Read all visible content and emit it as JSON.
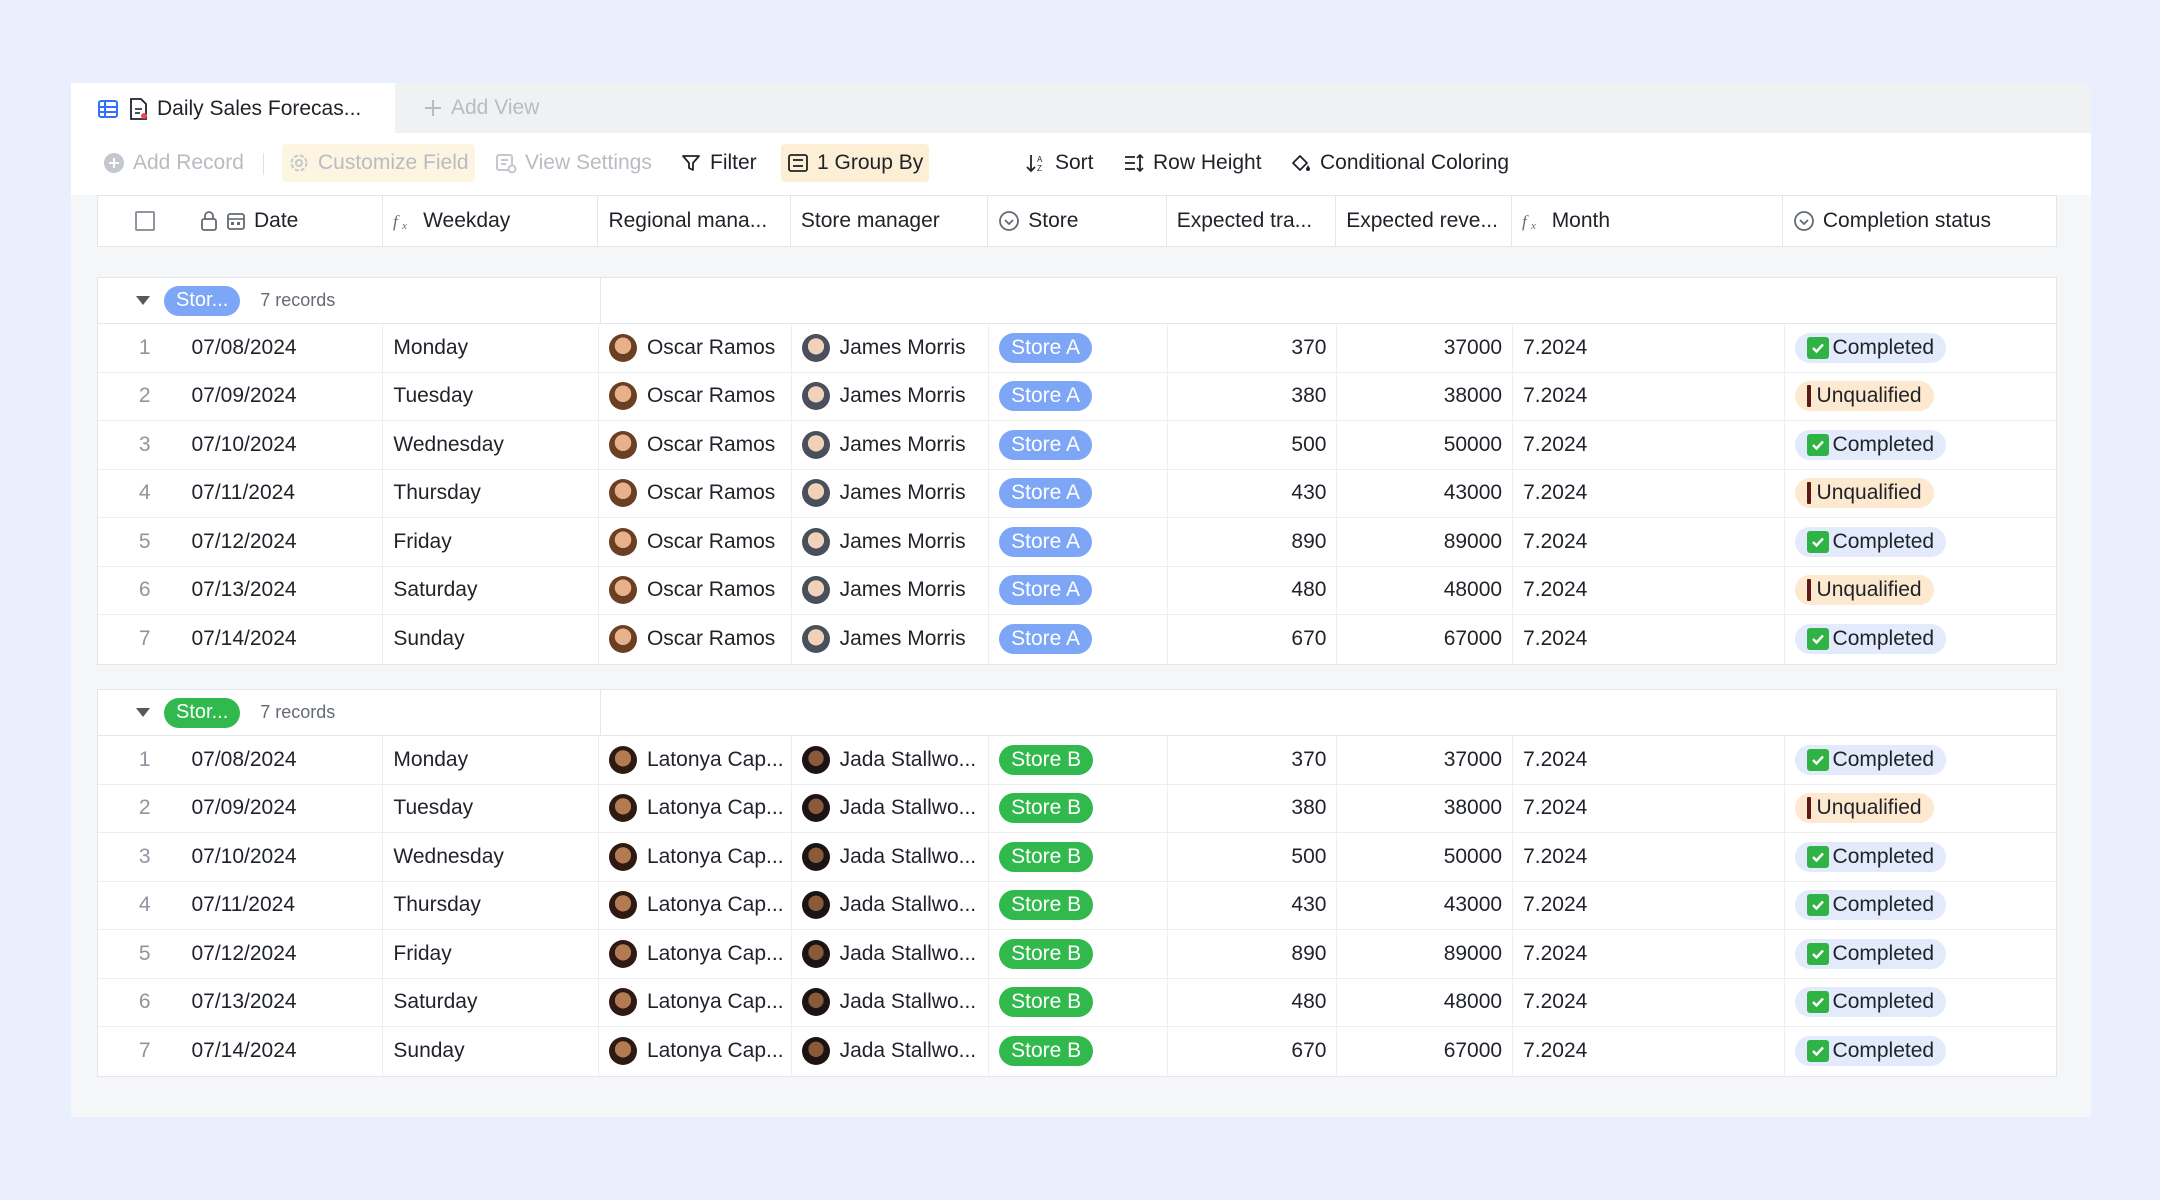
{
  "tabs": {
    "active_label": "Daily Sales Forecas...",
    "add_view_label": "Add View"
  },
  "toolbar": {
    "add_record": "Add Record",
    "customize_field": "Customize Field",
    "view_settings": "View Settings",
    "filter": "Filter",
    "group_by": "1 Group By",
    "sort": "Sort",
    "row_height": "Row Height",
    "conditional_coloring": "Conditional Coloring"
  },
  "columns": {
    "date": "Date",
    "weekday": "Weekday",
    "regional_manager": "Regional mana...",
    "store_manager": "Store manager",
    "store": "Store",
    "expected_traffic": "Expected tra...",
    "expected_revenue": "Expected reve...",
    "month": "Month",
    "completion_status": "Completion status"
  },
  "colors": {
    "store_a": "#7ea6f7",
    "store_b": "#31b94d",
    "completed_bg": "#e3eafb",
    "unqualified_bg": "#fde9cf"
  },
  "groups": [
    {
      "tag": "Stor...",
      "count": "7 records",
      "color": "#7ea6f7",
      "rows": [
        {
          "idx": "1",
          "date": "07/08/2024",
          "weekday": "Monday",
          "regional": "Oscar Ramos",
          "manager": "James Morris",
          "store": "Store A",
          "traffic": "370",
          "revenue": "37000",
          "month": "7.2024",
          "status": "Completed"
        },
        {
          "idx": "2",
          "date": "07/09/2024",
          "weekday": "Tuesday",
          "regional": "Oscar Ramos",
          "manager": "James Morris",
          "store": "Store A",
          "traffic": "380",
          "revenue": "38000",
          "month": "7.2024",
          "status": "Unqualified"
        },
        {
          "idx": "3",
          "date": "07/10/2024",
          "weekday": "Wednesday",
          "regional": "Oscar Ramos",
          "manager": "James Morris",
          "store": "Store A",
          "traffic": "500",
          "revenue": "50000",
          "month": "7.2024",
          "status": "Completed"
        },
        {
          "idx": "4",
          "date": "07/11/2024",
          "weekday": "Thursday",
          "regional": "Oscar Ramos",
          "manager": "James Morris",
          "store": "Store A",
          "traffic": "430",
          "revenue": "43000",
          "month": "7.2024",
          "status": "Unqualified"
        },
        {
          "idx": "5",
          "date": "07/12/2024",
          "weekday": "Friday",
          "regional": "Oscar Ramos",
          "manager": "James Morris",
          "store": "Store A",
          "traffic": "890",
          "revenue": "89000",
          "month": "7.2024",
          "status": "Completed"
        },
        {
          "idx": "6",
          "date": "07/13/2024",
          "weekday": "Saturday",
          "regional": "Oscar Ramos",
          "manager": "James Morris",
          "store": "Store A",
          "traffic": "480",
          "revenue": "48000",
          "month": "7.2024",
          "status": "Unqualified"
        },
        {
          "idx": "7",
          "date": "07/14/2024",
          "weekday": "Sunday",
          "regional": "Oscar Ramos",
          "manager": "James Morris",
          "store": "Store A",
          "traffic": "670",
          "revenue": "67000",
          "month": "7.2024",
          "status": "Completed"
        }
      ]
    },
    {
      "tag": "Stor...",
      "count": "7 records",
      "color": "#31b94d",
      "rows": [
        {
          "idx": "1",
          "date": "07/08/2024",
          "weekday": "Monday",
          "regional": "Latonya Cap...",
          "manager": "Jada Stallwo...",
          "store": "Store B",
          "traffic": "370",
          "revenue": "37000",
          "month": "7.2024",
          "status": "Completed"
        },
        {
          "idx": "2",
          "date": "07/09/2024",
          "weekday": "Tuesday",
          "regional": "Latonya Cap...",
          "manager": "Jada Stallwo...",
          "store": "Store B",
          "traffic": "380",
          "revenue": "38000",
          "month": "7.2024",
          "status": "Unqualified"
        },
        {
          "idx": "3",
          "date": "07/10/2024",
          "weekday": "Wednesday",
          "regional": "Latonya Cap...",
          "manager": "Jada Stallwo...",
          "store": "Store B",
          "traffic": "500",
          "revenue": "50000",
          "month": "7.2024",
          "status": "Completed"
        },
        {
          "idx": "4",
          "date": "07/11/2024",
          "weekday": "Thursday",
          "regional": "Latonya Cap...",
          "manager": "Jada Stallwo...",
          "store": "Store B",
          "traffic": "430",
          "revenue": "43000",
          "month": "7.2024",
          "status": "Completed"
        },
        {
          "idx": "5",
          "date": "07/12/2024",
          "weekday": "Friday",
          "regional": "Latonya Cap...",
          "manager": "Jada Stallwo...",
          "store": "Store B",
          "traffic": "890",
          "revenue": "89000",
          "month": "7.2024",
          "status": "Completed"
        },
        {
          "idx": "6",
          "date": "07/13/2024",
          "weekday": "Saturday",
          "regional": "Latonya Cap...",
          "manager": "Jada Stallwo...",
          "store": "Store B",
          "traffic": "480",
          "revenue": "48000",
          "month": "7.2024",
          "status": "Completed"
        },
        {
          "idx": "7",
          "date": "07/14/2024",
          "weekday": "Sunday",
          "regional": "Latonya Cap...",
          "manager": "Jada Stallwo...",
          "store": "Store B",
          "traffic": "670",
          "revenue": "67000",
          "month": "7.2024",
          "status": "Completed"
        }
      ]
    }
  ]
}
